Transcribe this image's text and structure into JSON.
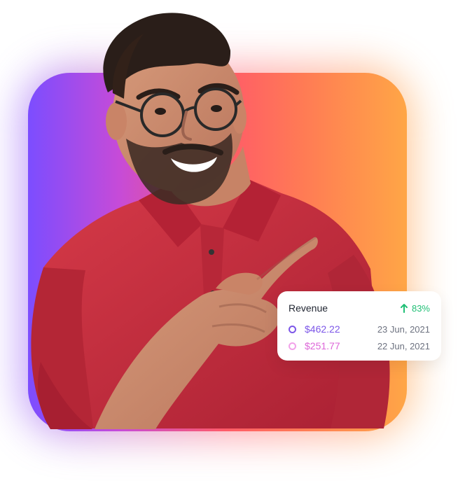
{
  "colors": {
    "gradient_start": "#7c4dff",
    "gradient_mid": "#ff5b68",
    "gradient_end": "#ffa646",
    "shirt": "#c92f3f",
    "growth_green": "#1fbf75",
    "series_purple": "#7c56e8",
    "series_pink": "#dd66d8"
  },
  "hero": {
    "image_description_icon": "person-pointing-icon"
  },
  "revenue_card": {
    "title": "Revenue",
    "growth": "83%",
    "growth_icon": "arrow-up-icon",
    "rows": [
      {
        "amount": "$462.22",
        "date": "23 Jun, 2021"
      },
      {
        "amount": "$251.77",
        "date": "22 Jun, 2021"
      }
    ]
  }
}
